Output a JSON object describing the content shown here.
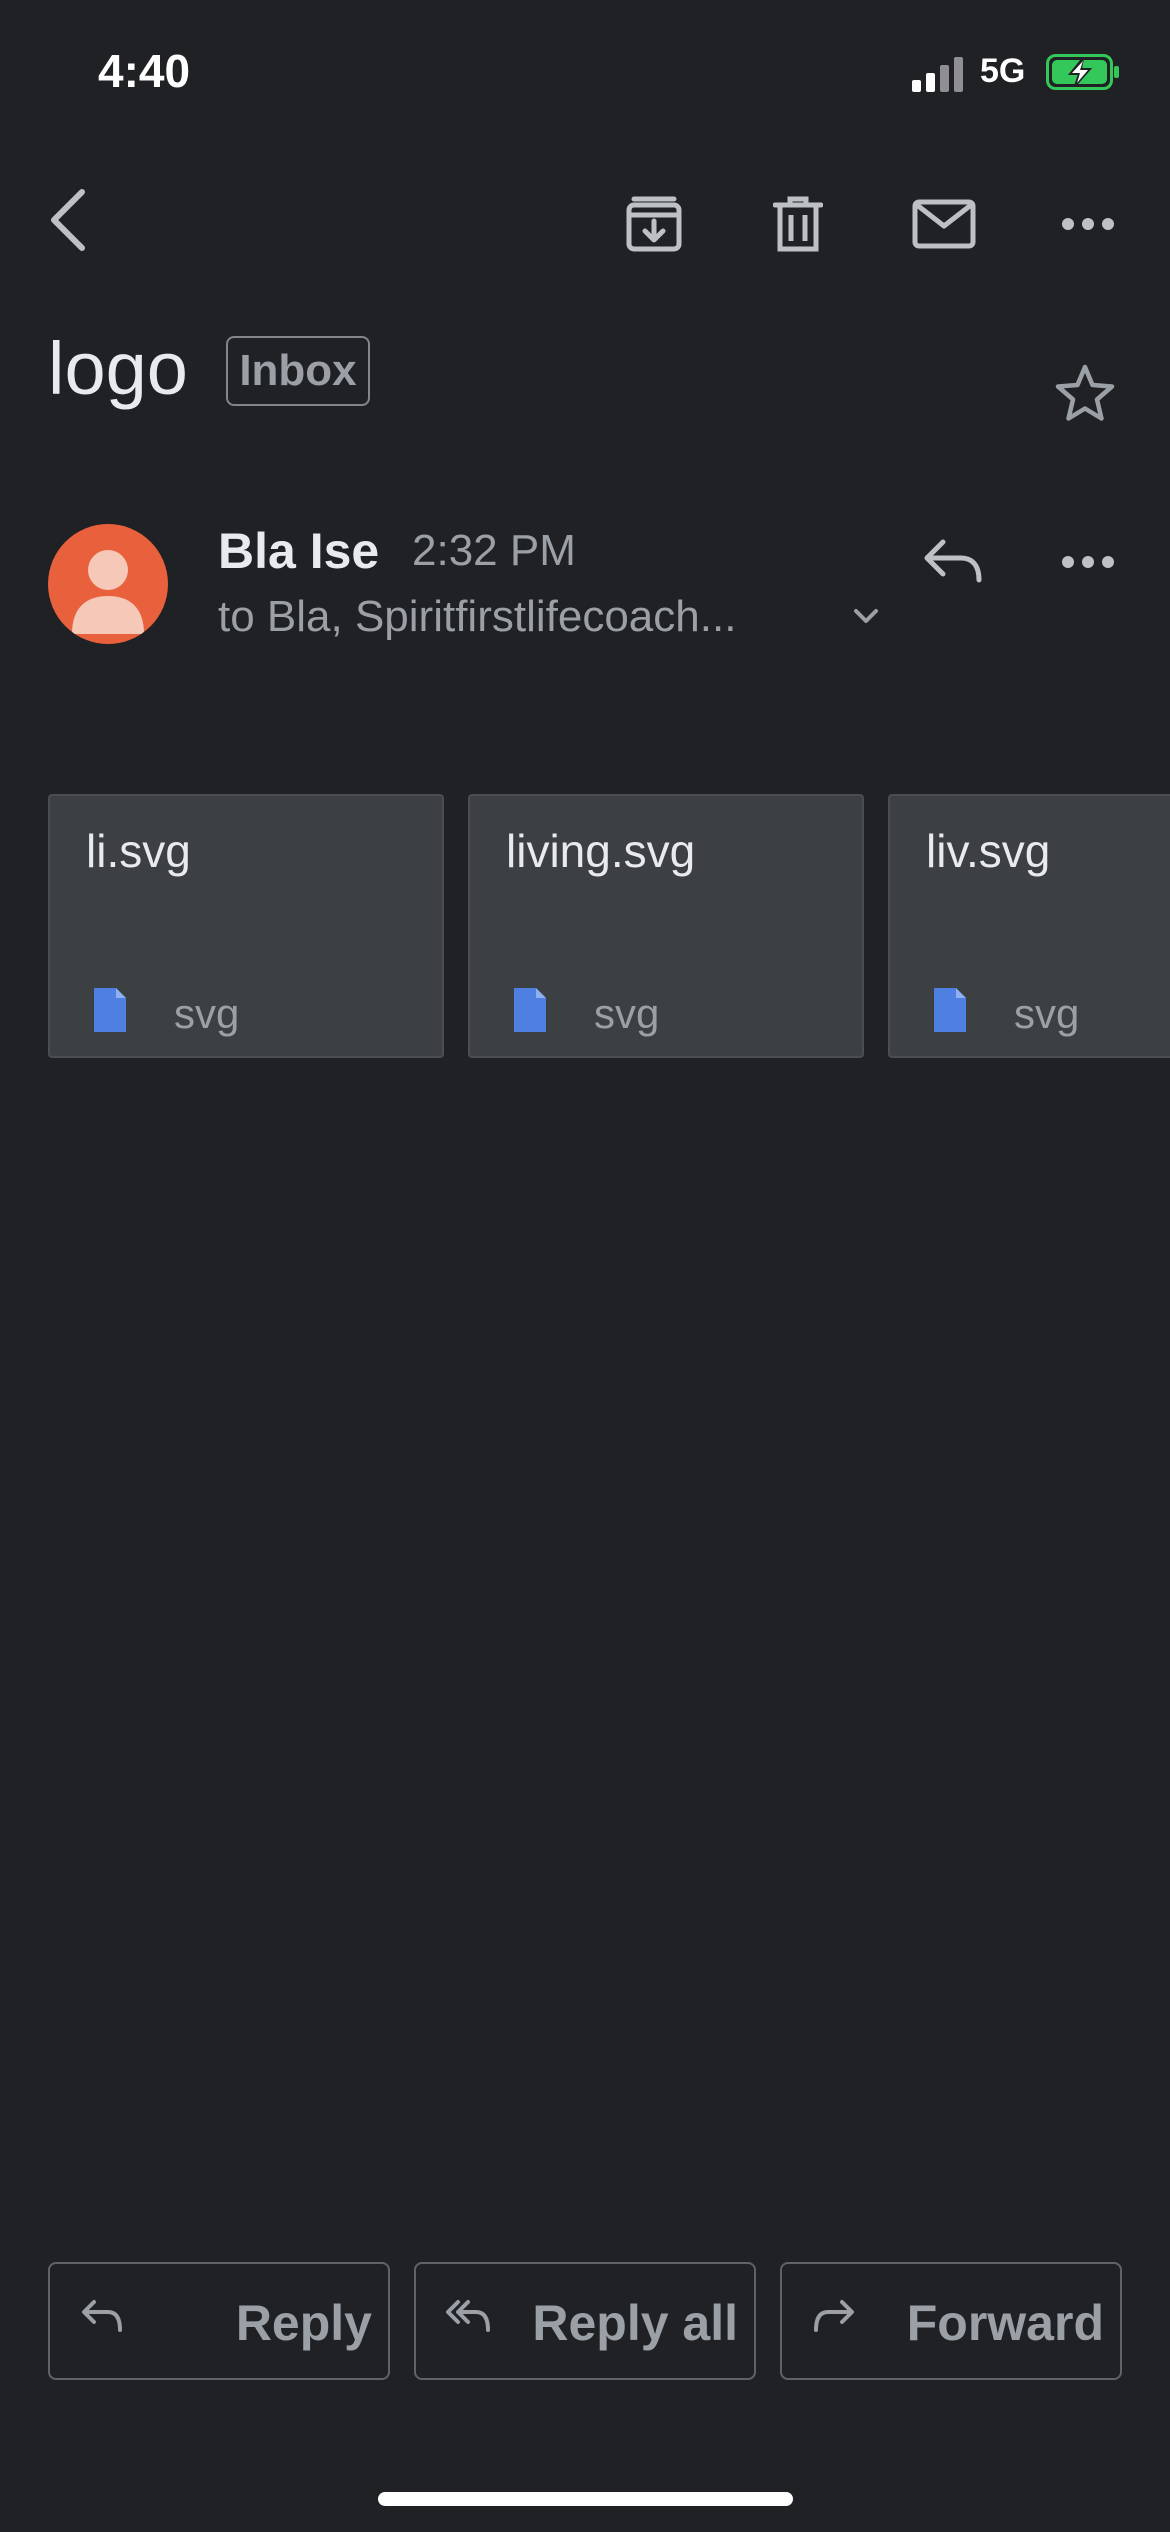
{
  "status_bar": {
    "time": "4:40",
    "network": "5G",
    "battery_color": "#34c759"
  },
  "toolbar": {
    "back_icon": "chevron-left-icon",
    "archive_icon": "archive-icon",
    "delete_icon": "trash-icon",
    "mark_unread_icon": "mail-icon",
    "more_icon": "more-horizontal-icon"
  },
  "email": {
    "subject": "logo",
    "label": "Inbox",
    "sender_name": "Bla Ise",
    "time": "2:32 PM",
    "recipients": "to Bla, Spiritfirstlifecoach...",
    "avatar_color": "#e8603c"
  },
  "attachments": [
    {
      "name": "li.svg",
      "type": "svg"
    },
    {
      "name": "living.svg",
      "type": "svg"
    },
    {
      "name": "liv.svg",
      "type": "svg"
    }
  ],
  "actions": {
    "reply": "Reply",
    "reply_all": "Reply all",
    "forward": "Forward"
  },
  "colors": {
    "background": "#202124",
    "card": "#3c4043",
    "file_icon": "#4f7fe0"
  }
}
